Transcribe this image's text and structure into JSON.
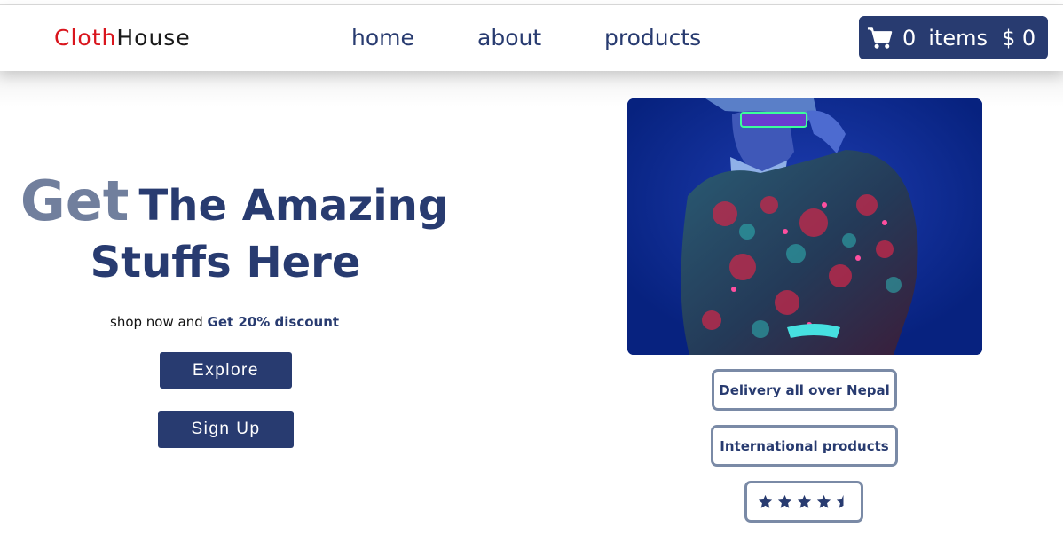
{
  "navbar": {
    "brand_part1": "Cloth",
    "brand_part2": "House",
    "links": [
      "home",
      "about",
      "products"
    ],
    "cart": {
      "icon": "cart-icon",
      "count": "0",
      "label": "items",
      "total": "$ 0"
    }
  },
  "hero": {
    "headline_get": "Get",
    "headline_rest": "The Amazing",
    "headline_line2": "Stuffs Here",
    "sub_text": "shop now and",
    "sub_highlight": "Get 20% discount",
    "explore_label": "Explore",
    "signup_label": "Sign Up"
  },
  "features": {
    "delivery": "Delivery all over Nepal",
    "international": "International products",
    "rating": 4.5,
    "rating_max": 5,
    "rating_icon": "star-icon"
  },
  "colors": {
    "brand_red": "#d9151d",
    "primary": "#283b70",
    "muted": "#717f9d",
    "badge_border": "#7a8aa6",
    "image_bg": "#0a2a8a"
  }
}
